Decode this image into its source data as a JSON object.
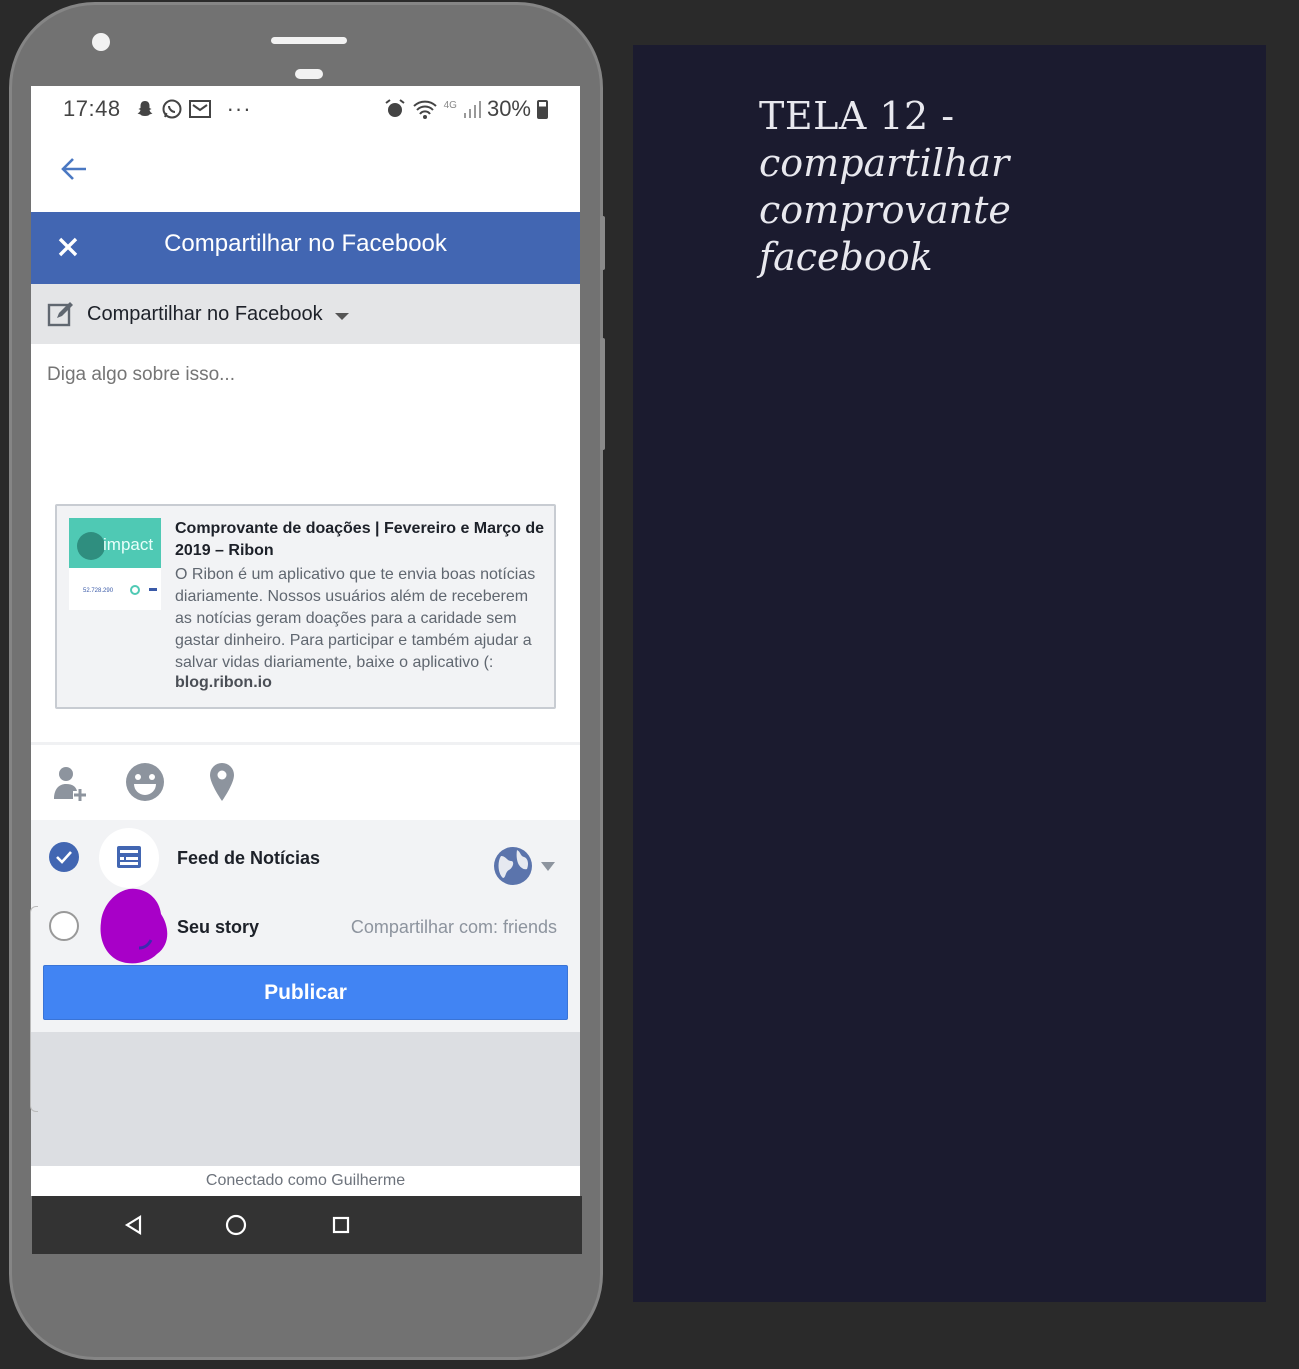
{
  "status_bar": {
    "time": "17:48",
    "network": "4G",
    "battery": "30%"
  },
  "fb_header": {
    "title": "Compartilhar no Facebook"
  },
  "destination": {
    "label": "Compartilhar no Facebook"
  },
  "compose": {
    "placeholder": "Diga algo sobre isso..."
  },
  "preview": {
    "title": "Comprovante de doações  |  Fevereiro e Março de 2019 – Ribon",
    "description": "O Ribon é um aplicativo que te envia boas notícias diariamente. Nossos usuários além de receberem as notícias geram doações para a caridade sem gastar dinheiro. Para participar e também ajudar a salvar vidas diariamente, baixe o aplicativo (:",
    "domain": "blog.ribon.io",
    "thumb_text": "impact",
    "thumb_number": "52.728.290"
  },
  "audience": {
    "feed_label": "Feed de Notícias",
    "story_label": "Seu story",
    "share_with": "Compartilhar com: friends"
  },
  "publish_label": "Publicar",
  "footer": {
    "connected_as": "Conectado como Guilherme"
  },
  "caption": {
    "line1": "TELA 12 -",
    "line2": "compartilhar",
    "line3": "comprovante",
    "line4": "facebook"
  },
  "colors": {
    "facebook_blue": "#4266b2",
    "publish_blue": "#4184f3",
    "panel_bg": "#1b1b2f"
  }
}
